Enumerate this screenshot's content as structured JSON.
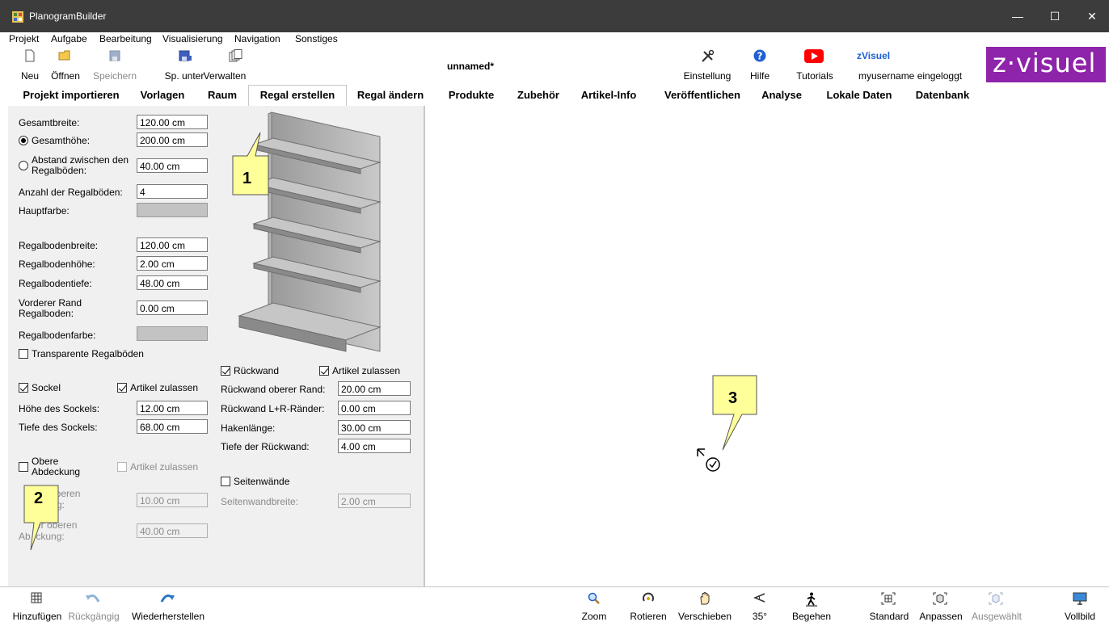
{
  "window": {
    "title": "PlanogramBuilder",
    "minimize": "—",
    "maximize": "☐",
    "close": "✕"
  },
  "menu": [
    "Projekt",
    "Aufgabe",
    "Bearbeitung",
    "Visualisierung",
    "Navigation",
    "Sonstiges"
  ],
  "toolbar": {
    "new": "Neu",
    "open": "Öffnen",
    "save": "Speichern",
    "save_as": "Sp. unter",
    "manage": "Verwalten",
    "project_name": "unnamed*",
    "settings": "Einstellung",
    "help": "Hilfe",
    "tutorials": "Tutorials",
    "user_brand": "zVisuel",
    "user_status": "myusername eingeloggt",
    "logo": "z·visuel"
  },
  "tabs": [
    "Projekt importieren",
    "Vorlagen",
    "Raum",
    "Regal erstellen",
    "Regal ändern",
    "Produkte",
    "Zubehör",
    "Artikel-Info",
    "Veröffentlichen",
    "Analyse",
    "Lokale Daten",
    "Datenbank"
  ],
  "active_tab": "Regal erstellen",
  "form": {
    "total_width_label": "Gesamtbreite:",
    "total_width": "120.00 cm",
    "total_height_label": "Gesamthöhe:",
    "total_height": "200.00 cm",
    "spacing_label_1": "Abstand zwischen den",
    "spacing_label_2": "Regalböden:",
    "spacing": "40.00 cm",
    "shelf_count_label": "Anzahl der Regalböden:",
    "shelf_count": "4",
    "main_color_label": "Hauptfarbe:",
    "shelf_width_label": "Regalbodenbreite:",
    "shelf_width": "120.00 cm",
    "shelf_height_label": "Regalbodenhöhe:",
    "shelf_height": "2.00 cm",
    "shelf_depth_label": "Regalbodentiefe:",
    "shelf_depth": "48.00 cm",
    "front_edge_label_1": "Vorderer Rand",
    "front_edge_label_2": "Regalboden:",
    "front_edge": "0.00 cm",
    "shelf_color_label": "Regalbodenfarbe:",
    "transparent_label": "Transparente Regalböden",
    "base_label": "Sockel",
    "base_allow_label": "Artikel zulassen",
    "base_height_label": "Höhe des Sockels:",
    "base_height": "12.00 cm",
    "base_depth_label": "Tiefe des Sockels:",
    "base_depth": "68.00 cm",
    "top_cover_label_1": "Obere",
    "top_cover_label_2": "Abdeckung",
    "top_allow_label": "Artikel zulassen",
    "top_cover_a_label_1": "oberen",
    "top_cover_a_label_2": "g:",
    "top_cover_a": "10.00 cm",
    "top_cover_b_label_1": "er oberen",
    "top_cover_b_label_2": "Ab  ckung:",
    "top_cover_b": "40.00 cm",
    "back_label": "Rückwand",
    "back_allow_label": "Artikel zulassen",
    "back_top_label": "Rückwand oberer Rand:",
    "back_top": "20.00 cm",
    "back_lr_label": "Rückwand L+R-Ränder:",
    "back_lr": "0.00 cm",
    "hook_label": "Hakenlänge:",
    "hook": "30.00 cm",
    "back_depth_label": "Tiefe der Rückwand:",
    "back_depth": "4.00 cm",
    "side_walls_label": "Seitenwände",
    "side_wall_width_label": "Seitenwandbreite:",
    "side_wall_width": "2.00 cm"
  },
  "callouts": [
    "1",
    "2",
    "3"
  ],
  "bottombar": {
    "add": "Hinzufügen",
    "undo": "Rückgängig",
    "redo": "Wiederherstellen",
    "zoom": "Zoom",
    "rotate": "Rotieren",
    "pan": "Verschieben",
    "angle": "35°",
    "walk": "Begehen",
    "standard": "Standard",
    "fit": "Anpassen",
    "selected": "Ausgewählt",
    "fullscreen": "Vollbild"
  },
  "colors": {
    "titlebar": "#3c3c3c",
    "panel": "#f0f0f0",
    "callout": "#ffff99",
    "shelf": "#c3c3c3"
  }
}
